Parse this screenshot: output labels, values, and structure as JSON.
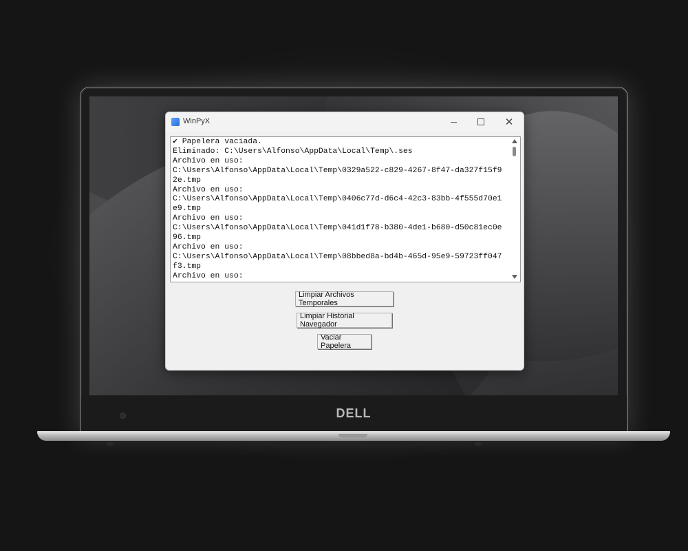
{
  "window": {
    "title": "WinPyX",
    "controls": {
      "minimize": "minimize-icon",
      "maximize": "maximize-icon",
      "close": "close-icon"
    }
  },
  "log": {
    "lines": [
      "✔ Papelera vaciada.",
      "Eliminado: C:\\Users\\Alfonso\\AppData\\Local\\Temp\\.ses",
      "Archivo en uso:",
      "C:\\Users\\Alfonso\\AppData\\Local\\Temp\\0329a522-c829-4267-8f47-da327f15f9",
      "2e.tmp",
      "Archivo en uso:",
      "C:\\Users\\Alfonso\\AppData\\Local\\Temp\\0406c77d-d6c4-42c3-83bb-4f555d70e1",
      "e9.tmp",
      "Archivo en uso:",
      "C:\\Users\\Alfonso\\AppData\\Local\\Temp\\041d1f78-b380-4de1-b680-d50c81ec0e",
      "96.tmp",
      "Archivo en uso:",
      "C:\\Users\\Alfonso\\AppData\\Local\\Temp\\08bbed8a-bd4b-465d-95e9-59723ff047",
      "f3.tmp",
      "Archivo en uso:"
    ]
  },
  "buttons": {
    "clean_temp": "Limpiar Archivos Temporales",
    "clean_history": "Limpiar Historial Navegador",
    "empty_bin": "Vaciar Papelera"
  },
  "device": {
    "logo": "DELL"
  }
}
